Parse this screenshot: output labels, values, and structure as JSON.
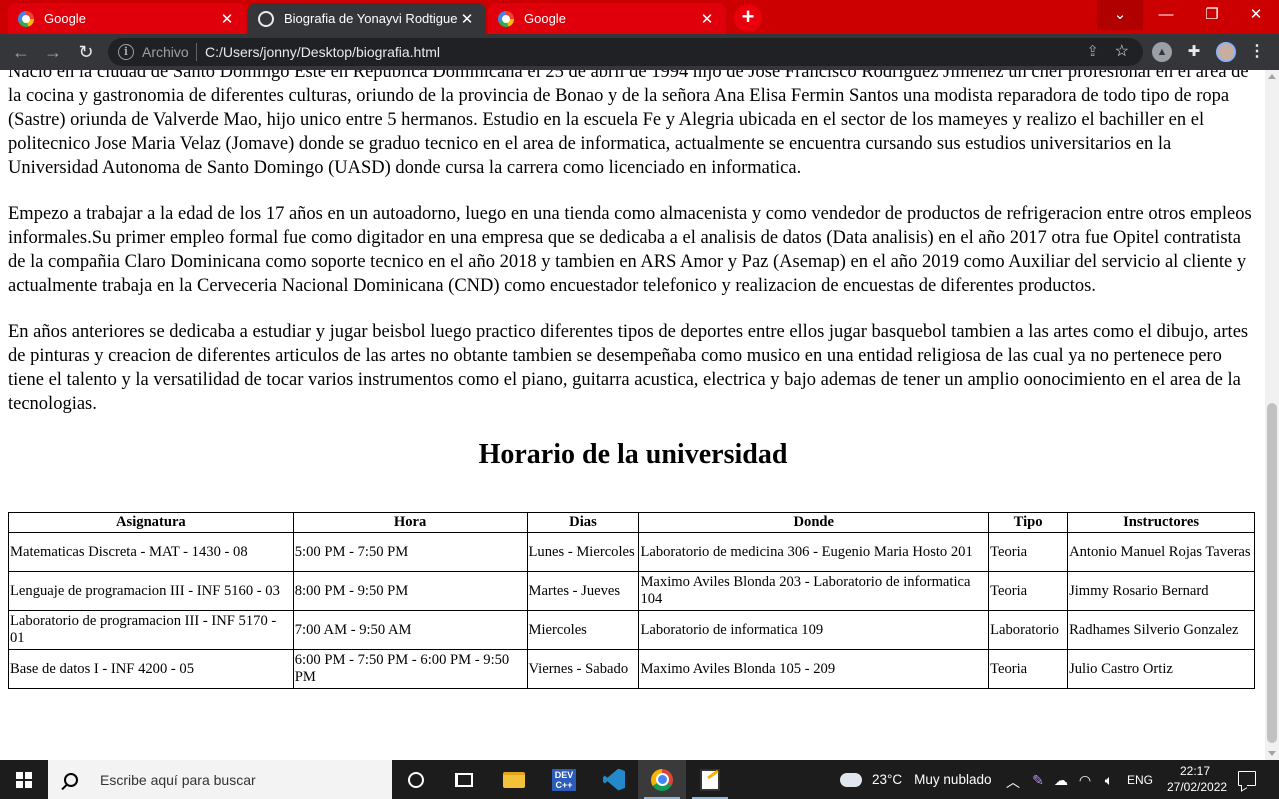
{
  "browser": {
    "tabs": [
      {
        "title": "Google",
        "icon": "google-icon",
        "active": false
      },
      {
        "title": "Biografia de Yonayvi Rodtiguez",
        "icon": "globe-icon",
        "active": true
      },
      {
        "title": "Google",
        "icon": "google-icon",
        "active": false
      }
    ],
    "close_glyph": "✕",
    "new_tab_glyph": "+",
    "window_controls": {
      "dropdown": "⌄",
      "minimize": "—",
      "maximize": "❐",
      "close": "✕"
    },
    "address": {
      "scheme_label": "Archivo",
      "url": "C:/Users/jonny/Desktop/biografia.html"
    },
    "colors": {
      "tabstrip": "#cc0000",
      "toolbar": "#35363a",
      "omnibox": "#202124"
    }
  },
  "page": {
    "paragraphs": [
      "Nacio en la ciudad de Santo Domingo Este en Republica Dominicana el 25 de abril de 1994 hijo de Jose Francisco Rodriguez Jimenez un chef profesional en el area de la cocina y gastronomia de diferentes culturas, oriundo de la provincia de Bonao y de la señora Ana Elisa Fermin Santos una modista reparadora de todo tipo de ropa (Sastre) oriunda de Valverde Mao, hijo unico entre 5 hermanos. Estudio en la escuela Fe y Alegria ubicada en el sector de los mameyes y realizo el bachiller en el politecnico Jose Maria Velaz (Jomave) donde se graduo tecnico en el area de informatica, actualmente se encuentra cursando sus estudios universitarios en la Universidad Autonoma de Santo Domingo (UASD) donde cursa la carrera como licenciado en informatica.",
      "Empezo a trabajar a la edad de los 17 años en un autoadorno, luego en una tienda como almacenista y como vendedor de productos de refrigeracion entre otros empleos informales.Su primer empleo formal fue como digitador en una empresa que se dedicaba a el analisis de datos (Data analisis) en el año 2017 otra fue Opitel contratista de la compañia Claro Dominicana como soporte tecnico en el año 2018 y tambien en ARS Amor y Paz (Asemap) en el año 2019 como Auxiliar del servicio al cliente y actualmente trabaja en la Cerveceria Nacional Dominicana (CND) como encuestador telefonico y realizacion de encuestas de diferentes productos.",
      "En años anteriores se dedicaba a estudiar y jugar beisbol luego practico diferentes tipos de deportes entre ellos jugar basquebol tambien a las artes como el dibujo, artes de pinturas y creacion de diferentes articulos de las artes no obtante tambien se desempeñaba como musico en una entidad religiosa de las cual ya no pertenece pero tiene el talento y la versatilidad de tocar varios instrumentos como el piano, guitarra acustica, electrica y bajo ademas de tener un amplio oonocimiento en el area de la tecnologias."
    ],
    "schedule_heading": "Horario de la universidad",
    "table": {
      "headers": [
        "Asignatura",
        "Hora",
        "Dias",
        "Donde",
        "Tipo",
        "Instructores"
      ],
      "rows": [
        [
          "Matematicas Discreta - MAT - 1430 - 08",
          "5:00 PM - 7:50 PM",
          "Lunes - Miercoles",
          "Laboratorio de medicina 306 - Eugenio Maria Hosto 201",
          "Teoria",
          "Antonio Manuel Rojas Taveras"
        ],
        [
          "Lenguaje de programacion III - INF 5160 - 03",
          "8:00 PM - 9:50 PM",
          "Martes - Jueves",
          "Maximo Aviles Blonda 203 - Laboratorio de informatica 104",
          "Teoria",
          "Jimmy Rosario Bernard"
        ],
        [
          "Laboratorio de programacion III - INF 5170 - 01",
          "7:00 AM - 9:50 AM",
          "Miercoles",
          "Laboratorio de informatica 109",
          "Laboratorio",
          "Radhames Silverio Gonzalez"
        ],
        [
          "Base de datos I - INF 4200 - 05",
          "6:00 PM - 7:50 PM - 6:00 PM - 9:50 PM",
          "Viernes - Sabado",
          "Maximo Aviles Blonda 105 - 209",
          "Teoria",
          "Julio Castro Ortiz"
        ]
      ]
    }
  },
  "taskbar": {
    "search_placeholder": "Escribe aquí para buscar",
    "weather": {
      "temp": "23°C",
      "condition": "Muy nublado"
    },
    "language": "ENG",
    "time": "22:17",
    "date": "27/02/2022",
    "dev_label": "DEV\nC++"
  }
}
